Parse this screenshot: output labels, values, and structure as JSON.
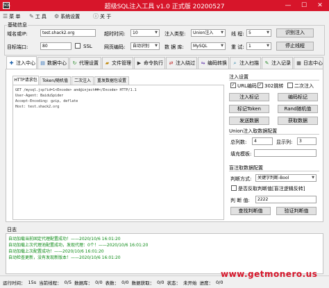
{
  "window": {
    "title": "超级SQL注入工具 v1.0 正式版 20200527",
    "app_icon": "SQL",
    "controls": [
      "—",
      "☐",
      "✕"
    ]
  },
  "menu": {
    "items": [
      {
        "label": "菜 单",
        "icon": "menu-icon"
      },
      {
        "label": "工 具",
        "icon": "wrench-icon"
      },
      {
        "label": "系统设置",
        "icon": "gear-icon"
      },
      {
        "label": "关 于",
        "icon": "info-icon"
      }
    ]
  },
  "basic": {
    "group_label": "基础信息",
    "host_label": "域名或IP:",
    "host_value": "test.shack2.org",
    "port_label": "目标端口:",
    "port_value": "80",
    "ssl_label": "SSL",
    "timeout_label": "超时时间:",
    "timeout_value": "10",
    "encoding_label": "网页编码:",
    "encoding_value": "自动识别",
    "inject_type_label": "注入类型:",
    "inject_type_value": "Union注入",
    "db_label": "数 据 库:",
    "db_value": "MySQL",
    "threads_label": "线 程:",
    "threads_value": "5",
    "retry_label": "重 试:",
    "retry_value": "1",
    "detect_button": "识别注入",
    "stop_button": "停止线程"
  },
  "main_tabs": [
    {
      "label": "注入中心",
      "icon": "syringe-icon"
    },
    {
      "label": "数据中心",
      "icon": "database-icon"
    },
    {
      "label": "代理设置",
      "icon": "proxy-icon"
    },
    {
      "label": "文件管理",
      "icon": "folder-icon"
    },
    {
      "label": "命令执行",
      "icon": "terminal-icon"
    },
    {
      "label": "注入绕过",
      "icon": "bypass-icon"
    },
    {
      "label": "编码转换",
      "icon": "convert-icon"
    },
    {
      "label": "注入扫描",
      "icon": "scan-icon"
    },
    {
      "label": "注入记录",
      "icon": "record-icon"
    },
    {
      "label": "日志中心",
      "icon": "log-icon"
    }
  ],
  "sub_tabs": [
    "HTTP请求包",
    "Token/随机值",
    "二次注入",
    "重发数据包设置"
  ],
  "request": [
    "GET /mysql.jsp?id=1<Encode> and@inject##</Encode> HTTP/1.1",
    "User-Agent: BaiduSpider",
    "Accept-Encoding: gzip, deflate",
    "Host: test.shack2.org"
  ],
  "inject_settings": {
    "title": "注入设置",
    "url_encode_label": "URL编码",
    "jump_302_label": "302跳转",
    "second_inject_label": "二次注入",
    "mark_inject_button": "注入标记",
    "mark_encode_button": "编码标记",
    "mark_token_button": "标记Token",
    "mark_rand_button": "Rand随机值",
    "send_button": "发送数据",
    "fetch_button": "获取数据"
  },
  "union_config": {
    "title": "Union注入取数据配置",
    "total_cols_label": "总列数:",
    "total_cols_value": "4",
    "show_col_label": "显示列:",
    "show_col_value": "3",
    "fill_template_label": "填充模板:"
  },
  "blind_config": {
    "title": "盲注取数据配置",
    "judge_mode_label": "判断方式:",
    "judge_mode_value": "关键字判断-Bool",
    "reverse_label": "是否反取判断值[盲注逻辑反转]",
    "judge_value_label": "判 断 值:",
    "judge_value": "2222",
    "find_button": "查找判断值",
    "verify_button": "验证判断值"
  },
  "log": {
    "title": "日志",
    "lines": [
      "自动加载当前固定代理配置成功！——2020/10/6 16:01:20",
      "自动加载上次代理池配置成功，发现代理：0个！——2020/10/6 16:01:20",
      "自动加载上次配置成功！——2020/10/6 16:01:20",
      "自动检查更新，没有发现新版本！——2020/10/6 16:01:20"
    ]
  },
  "status": [
    "运行时间：",
    "15s",
    "当前线程：",
    "0/5",
    "数据库：",
    "0/0",
    "表数：",
    "0/0",
    "数据获取：",
    "0/0",
    "状态：",
    "未开始",
    "进度：",
    "0/0"
  ],
  "watermark": "www.getmonero.us",
  "colors": {
    "title_bar": "#d7152a",
    "log_text": "#0a8a14"
  }
}
